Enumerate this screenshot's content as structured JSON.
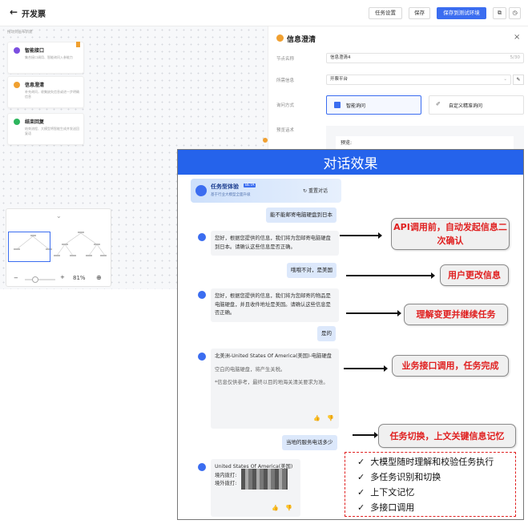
{
  "header": {
    "back_icon": "←",
    "title": "开发票",
    "task_settings": "任务设置",
    "save": "保存",
    "save_test": "保存到测试环境"
  },
  "canvas": {
    "hint": "拖动到画布新建",
    "nodes": [
      {
        "name": "智能接口",
        "desc": "集合接口调用、智能询问入参能力",
        "color": "#7b4fe0"
      },
      {
        "name": "信息澄清",
        "desc": "补充询问，收集缺失信息或进一步明确信息",
        "color": "#f0a030"
      },
      {
        "name": "结束回复",
        "desc": "结束流程、大模型将智能生成并发送回复语",
        "color": "#2db55d"
      }
    ],
    "zoom": "81%",
    "zoom_minus": "−",
    "zoom_plus": "+"
  },
  "panel": {
    "title": "信息澄清",
    "close": "×",
    "name_label": "节点名称",
    "name_value": "信息澄清4",
    "name_count": "5/30",
    "info_label": "所需信息",
    "info_value": "开票平台",
    "mode_label": "询问方式",
    "mode_smart": "智能询问",
    "mode_custom": "自定义精准询问",
    "preview_label": "预览话术",
    "preview_text": "预览:"
  },
  "overlay": {
    "title": "对话效果",
    "chat": {
      "name": "任务型体验",
      "badge": "BETA",
      "sub": "基于行业大模型全面升级",
      "reset": "重置对话",
      "user1": "能不能邮寄电脑硬盘到日本",
      "bot1": "您好，根据您提供的信息，我们将为您邮寄电脑硬盘到日本。请确认这些信息是否正确。",
      "user2": "哦哦不对，是美国",
      "bot2": "您好，根据您提供的信息，我们将为您邮寄的物品是电脑硬盘，并且收件地址是美国。请确认这些信息是否正确。",
      "user3": "是的",
      "bot3_title": "北美洲-United States Of America(美国)-电脑硬盘",
      "bot3_line": "空白的电脑硬盘，将产生关税。",
      "bot3_note": "*信息仅供参考，最终以目的地海关清关要求为准。",
      "user4": "当地的服务电话多少",
      "bot4_title": "United States Of America(美国)",
      "bot4_in": "境内拨打:",
      "bot4_out": "境外拨打:"
    },
    "annotations": [
      "API调用前，自动发起信息二次确认",
      "用户更改信息",
      "理解变更并继续任务",
      "业务接口调用，任务完成",
      "任务切换，上文关键信息记忆"
    ],
    "features": [
      "大模型随时理解和校验任务执行",
      "多任务识别和切换",
      "上下文记忆",
      "多接口调用"
    ],
    "check": "✓"
  }
}
